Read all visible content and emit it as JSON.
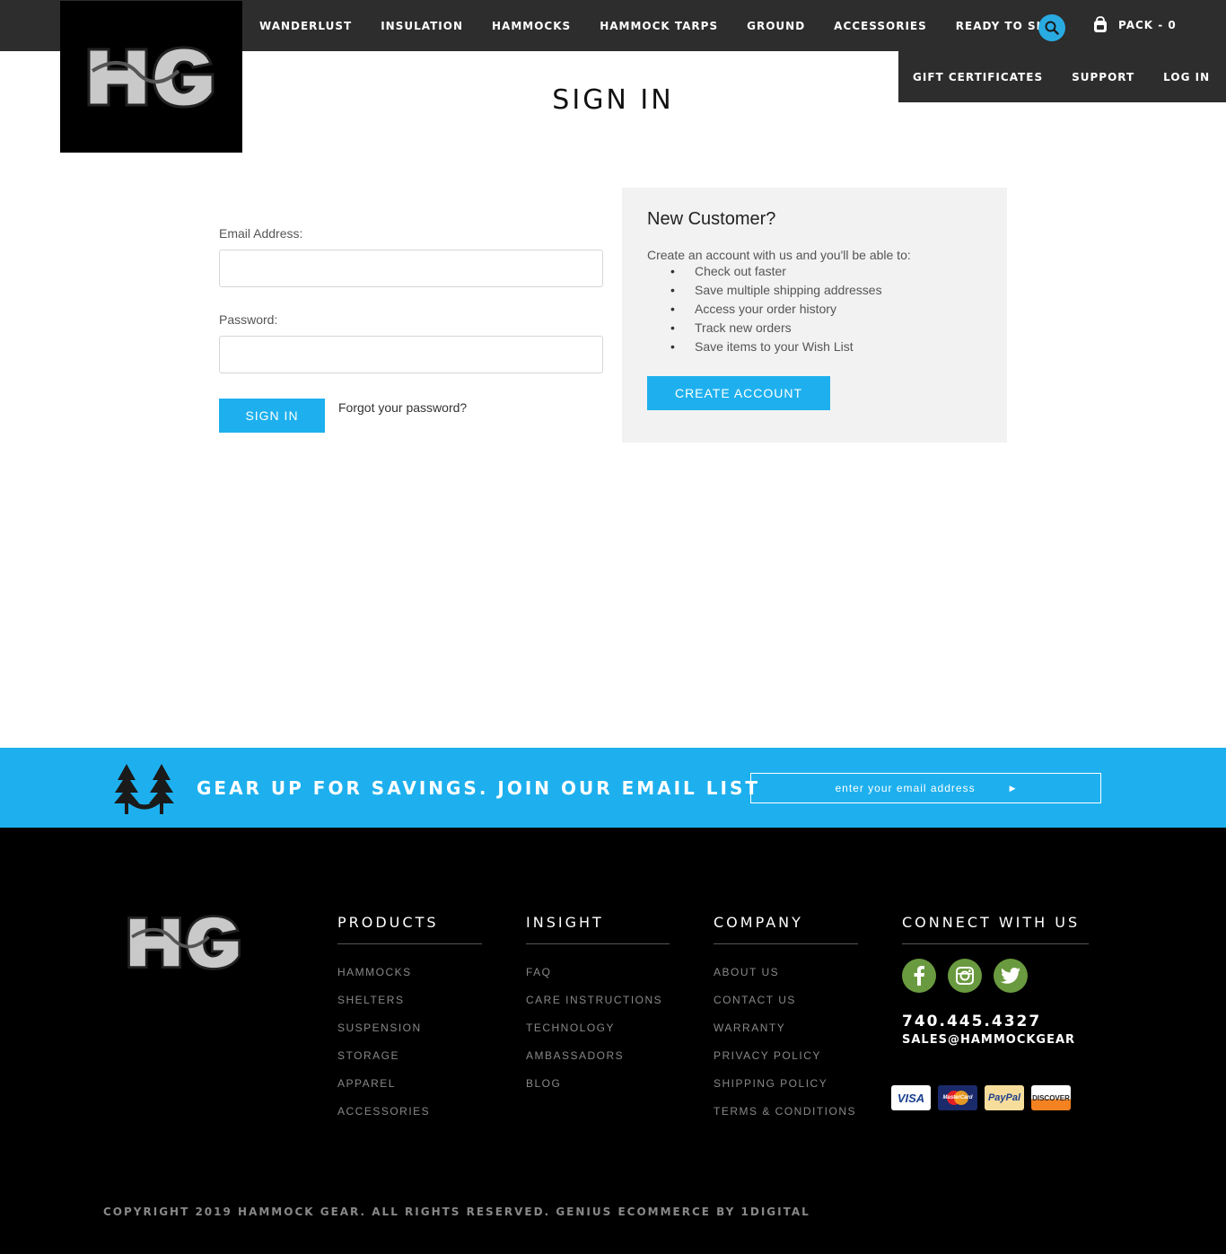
{
  "nav": {
    "items": [
      "WANDERLUST",
      "INSULATION",
      "HAMMOCKS",
      "HAMMOCK TARPS",
      "GROUND",
      "ACCESSORIES",
      "READY TO SHIP"
    ],
    "pack_label": "PACK - 0",
    "search_icon": "search-icon",
    "bag_icon": "backpack-icon"
  },
  "subnav": {
    "items": [
      "GIFT CERTIFICATES",
      "SUPPORT",
      "LOG IN"
    ]
  },
  "logo": {
    "text": "HG"
  },
  "page": {
    "title": "SIGN IN"
  },
  "login": {
    "email_label": "Email Address:",
    "email_value": "",
    "password_label": "Password:",
    "password_value": "",
    "submit_label": "SIGN IN",
    "forgot_label": "Forgot your password?"
  },
  "new_customer": {
    "heading": "New Customer?",
    "intro": "Create an account with us and you'll be able to:",
    "benefits": [
      "Check out faster",
      "Save multiple shipping addresses",
      "Access your order history",
      "Track new orders",
      "Save items to your Wish List"
    ],
    "button_label": "CREATE ACCOUNT"
  },
  "newsletter": {
    "heading": "GEAR UP FOR SAVINGS. JOIN OUR EMAIL LIST",
    "placeholder": "enter your email address",
    "submit_icon": "arrow-right-icon"
  },
  "footer": {
    "products": {
      "title": "PRODUCTS",
      "links": [
        "HAMMOCKS",
        "SHELTERS",
        "SUSPENSION",
        "STORAGE",
        "APPAREL",
        "ACCESSORIES"
      ]
    },
    "insight": {
      "title": "INSIGHT",
      "links": [
        "FAQ",
        "CARE INSTRUCTIONS",
        "TECHNOLOGY",
        "AMBASSADORS",
        "BLOG"
      ]
    },
    "company": {
      "title": "COMPANY",
      "links": [
        "ABOUT US",
        "CONTACT US",
        "WARRANTY",
        "PRIVACY POLICY",
        "SHIPPING POLICY",
        "TERMS & CONDITIONS"
      ]
    },
    "connect": {
      "title": "CONNECT WITH US",
      "social_icons": [
        "facebook-icon",
        "instagram-icon",
        "twitter-icon"
      ],
      "phone": "740.445.4327",
      "email": "SALES@HAMMOCKGEAR"
    },
    "cards": [
      "VISA",
      "MasterCard",
      "PayPal",
      "DISCOVER"
    ],
    "copyright": "COPYRIGHT 2019 HAMMOCK GEAR. ALL RIGHTS RESERVED. GENIUS ECOMMERCE BY 1DIGITAL"
  },
  "colors": {
    "accent": "#1eb0ee",
    "dark": "#2d2d2d",
    "social": "#6a9a3f"
  }
}
